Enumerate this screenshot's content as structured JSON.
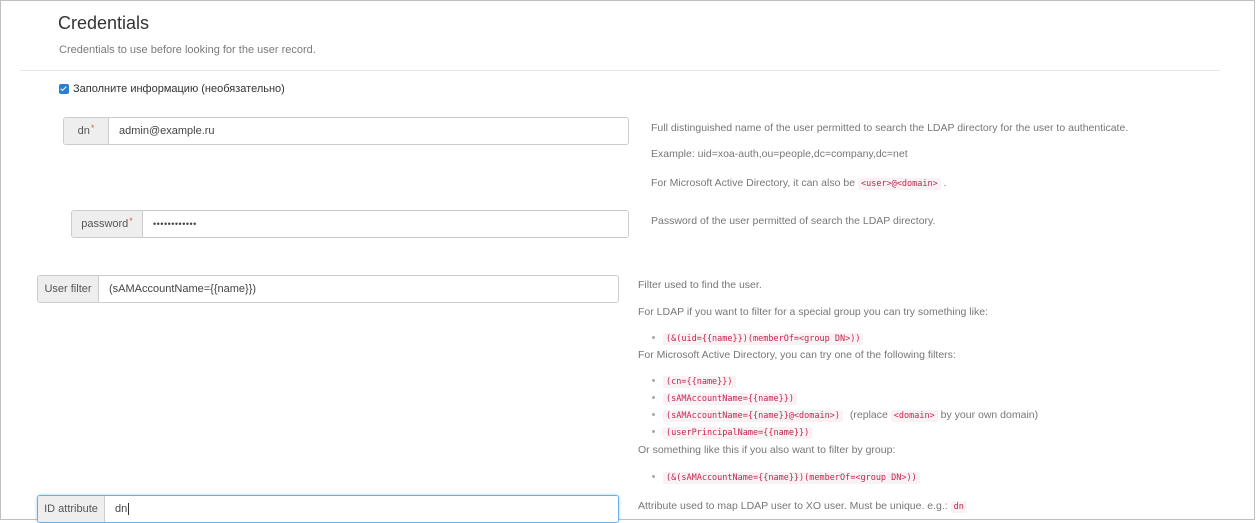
{
  "section": {
    "title": "Credentials",
    "subtitle": "Credentials to use before looking for the user record."
  },
  "fill_info": {
    "label": "Заполните информацию (необязательно)",
    "checked": true
  },
  "dn": {
    "label": "dn",
    "required_mark": "*",
    "value": "admin@example.ru",
    "help1": "Full distinguished name of the user permitted to search the LDAP directory for the user to authenticate.",
    "help2": "Example: uid=xoa-auth,ou=people,dc=company,dc=net",
    "help3_pre": "For Microsoft Active Directory, it can also be",
    "help3_code": "<user>@<domain>",
    "help3_post": "."
  },
  "password": {
    "label": "password",
    "required_mark": "*",
    "value": "••••••••••••",
    "help": "Password of the user permitted of search the LDAP directory."
  },
  "user_filter": {
    "label": "User filter",
    "value": "(sAMAccountName={{name}})",
    "help1": "Filter used to find the user.",
    "help2": "For LDAP if you want to filter for a special group you can try something like:",
    "ldap_example": "(&(uid={{name}})(memberOf=<group DN>))",
    "help3": "For Microsoft Active Directory, you can try one of the following filters:",
    "ad_examples": [
      "(cn={{name}})",
      "(sAMAccountName={{name}})",
      "(sAMAccountName={{name}}@<domain>)",
      "(userPrincipalName={{name}})"
    ],
    "replace_pre": "(replace",
    "replace_code": "<domain>",
    "replace_post": "by your own domain)",
    "help4": "Or something like this if you also want to filter by group:",
    "group_example": "(&(sAMAccountName={{name}})(memberOf=<group DN>))"
  },
  "id_attribute": {
    "label": "ID attribute",
    "value": "dn",
    "help_pre": "Attribute used to map LDAP user to XO user. Must be unique. e.g.:",
    "help_code": "dn"
  }
}
